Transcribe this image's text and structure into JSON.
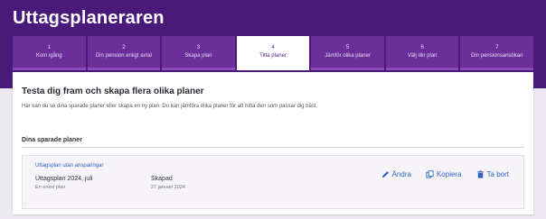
{
  "app": {
    "title": "Uttagsplaneraren"
  },
  "steps": [
    {
      "num": "1",
      "label": "Kom igång"
    },
    {
      "num": "2",
      "label": "Din pension enligt avtal"
    },
    {
      "num": "3",
      "label": "Skapa plan"
    },
    {
      "num": "4",
      "label": "Titta planer"
    },
    {
      "num": "5",
      "label": "Jämför olika planer"
    },
    {
      "num": "6",
      "label": "Välj din plan"
    },
    {
      "num": "7",
      "label": "Din pensionsansökan"
    }
  ],
  "main": {
    "heading": "Testa dig fram och skapa flera olika planer",
    "description": "Här kan du se dina sparade planer eller skapa en ny plan. Du kan jämföra olika planer för att hitta den som passar dig bäst.",
    "saved_label": "Dina sparade planer",
    "plan": {
      "link": "Uttagsplan utan ansparingar",
      "name": "Uttagsplan 2024, juli",
      "sub": "En enkel plan",
      "status": "Skapad",
      "date": "27 januari 2024"
    },
    "actions": {
      "edit": "Ändra",
      "copy": "Kopiera",
      "delete": "Ta bort"
    }
  }
}
